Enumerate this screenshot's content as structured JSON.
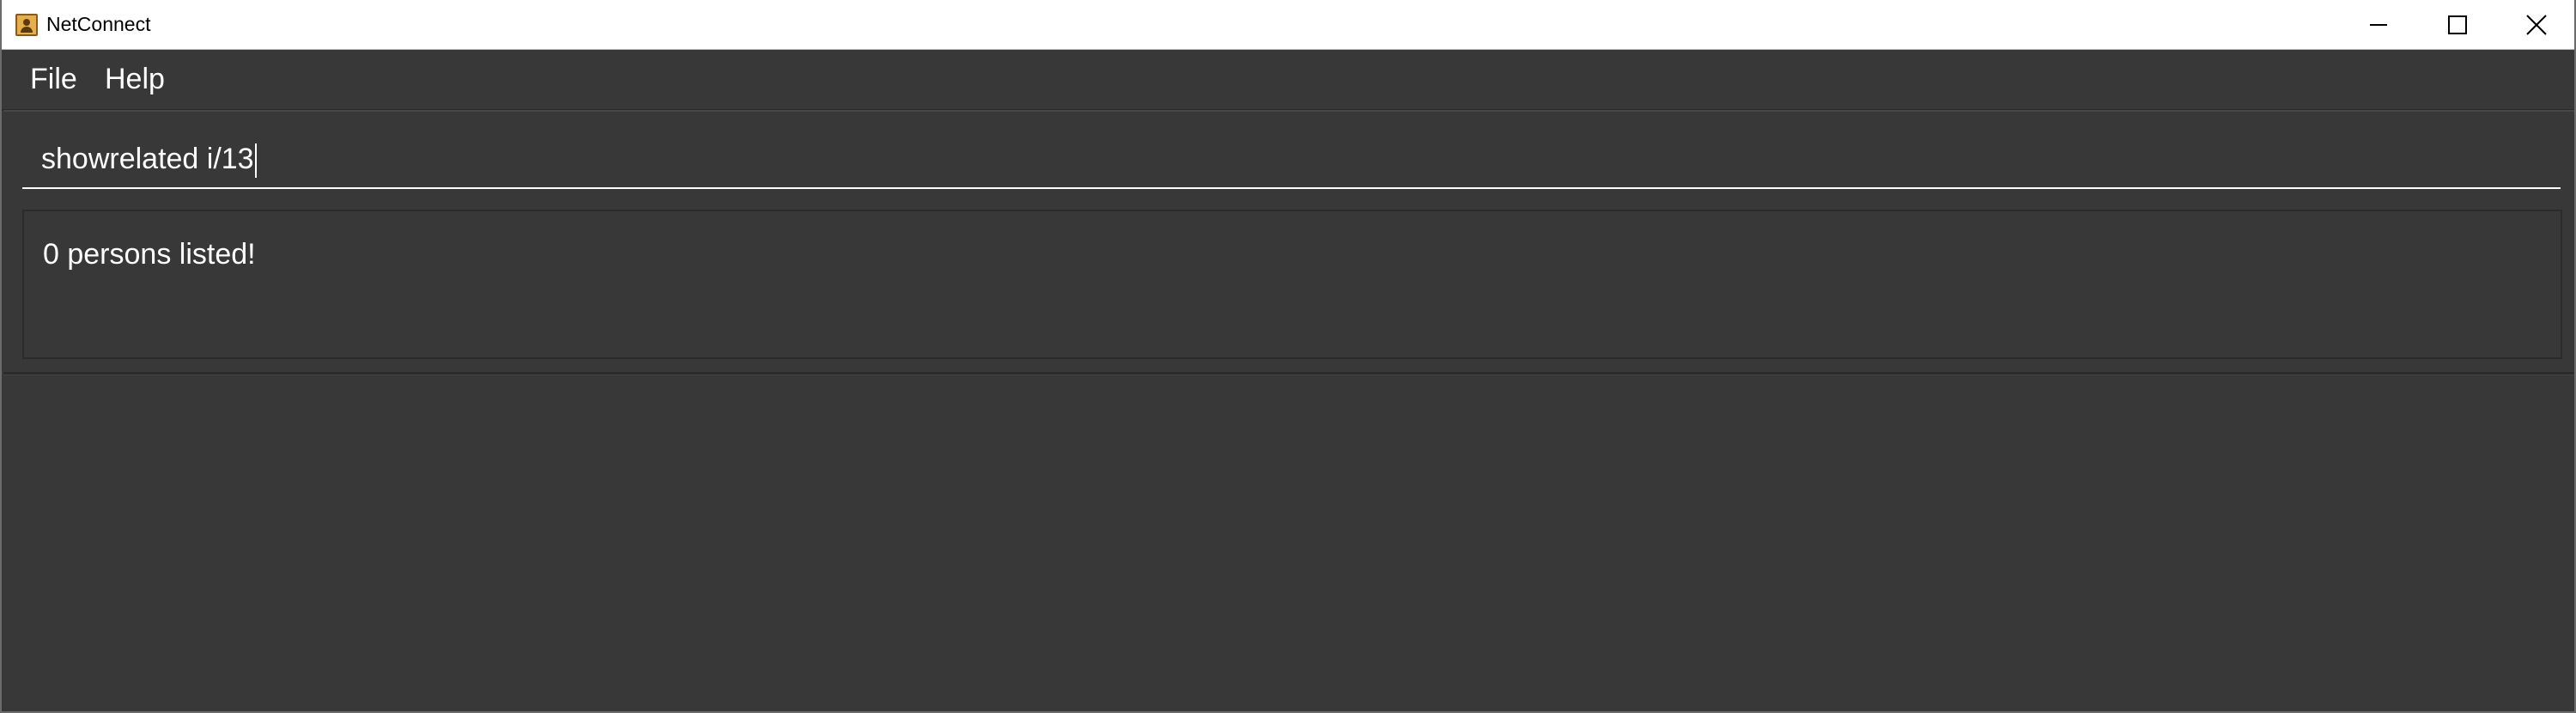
{
  "window": {
    "title": "NetConnect"
  },
  "menu": {
    "items": [
      {
        "label": "File"
      },
      {
        "label": "Help"
      }
    ]
  },
  "command_box": {
    "value": "showrelated i/13"
  },
  "result_display": {
    "text": "0 persons listed!"
  },
  "person_list": {
    "items": []
  },
  "icons": {
    "app": "contact-book-icon",
    "minimize": "minimize-icon",
    "maximize": "maximize-icon",
    "close": "close-icon"
  },
  "colors": {
    "background": "#383838",
    "text": "#ffffff",
    "titlebar": "#ffffff"
  }
}
